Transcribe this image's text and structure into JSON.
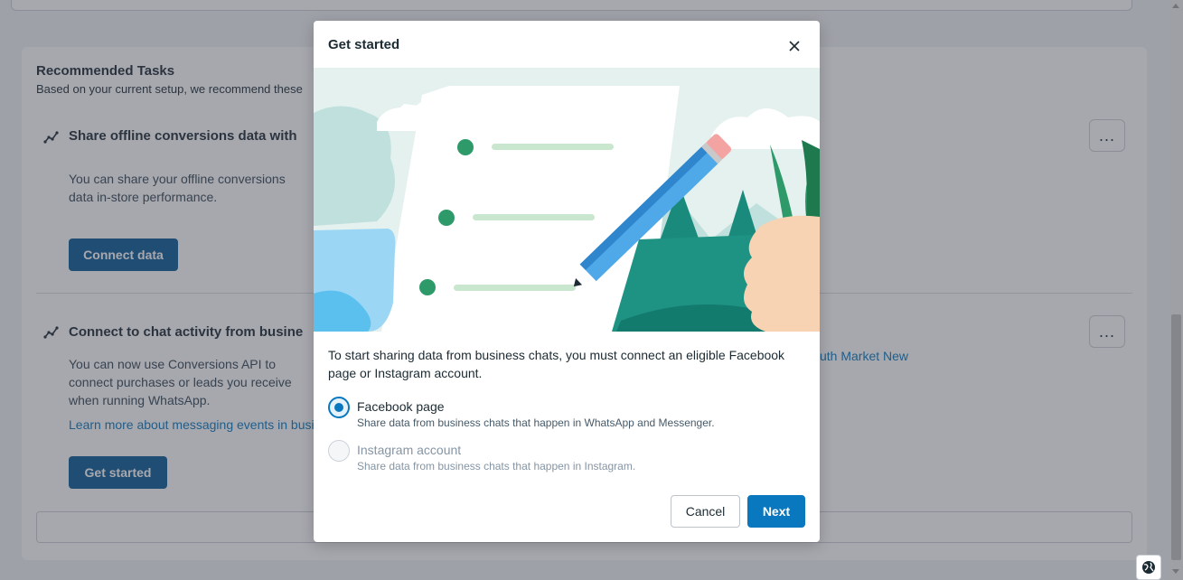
{
  "background": {
    "recommended": {
      "title": "Recommended Tasks",
      "subtitle": "Based on your current setup, we recommend these"
    },
    "task1": {
      "title": "Share offline conversions data with",
      "description": "You can share your offline conversions data  in-store performance.",
      "button": "Connect data",
      "more": "..."
    },
    "task2": {
      "title": "Connect to chat activity from busine",
      "description": "You can now use Conversions API to connect purchases or leads you receive when running WhatsApp.",
      "link": "Learn more about messaging events in busi",
      "right_link": "uth Market New",
      "button": "Get started",
      "more": "..."
    }
  },
  "modal": {
    "title": "Get started",
    "intro": "To start sharing data from business chats, you must connect an eligible Facebook page or Instagram account.",
    "options": [
      {
        "label": "Facebook page",
        "description": "Share data from business chats that happen in WhatsApp and Messenger.",
        "selected": true,
        "disabled": false
      },
      {
        "label": "Instagram account",
        "description": "Share data from business chats that happen in Instagram.",
        "selected": false,
        "disabled": true
      }
    ],
    "cancel": "Cancel",
    "next": "Next"
  },
  "colors": {
    "primary": "#0a78be",
    "primary_dark": "#0a5a96",
    "overlay": "#3c3e4b"
  }
}
